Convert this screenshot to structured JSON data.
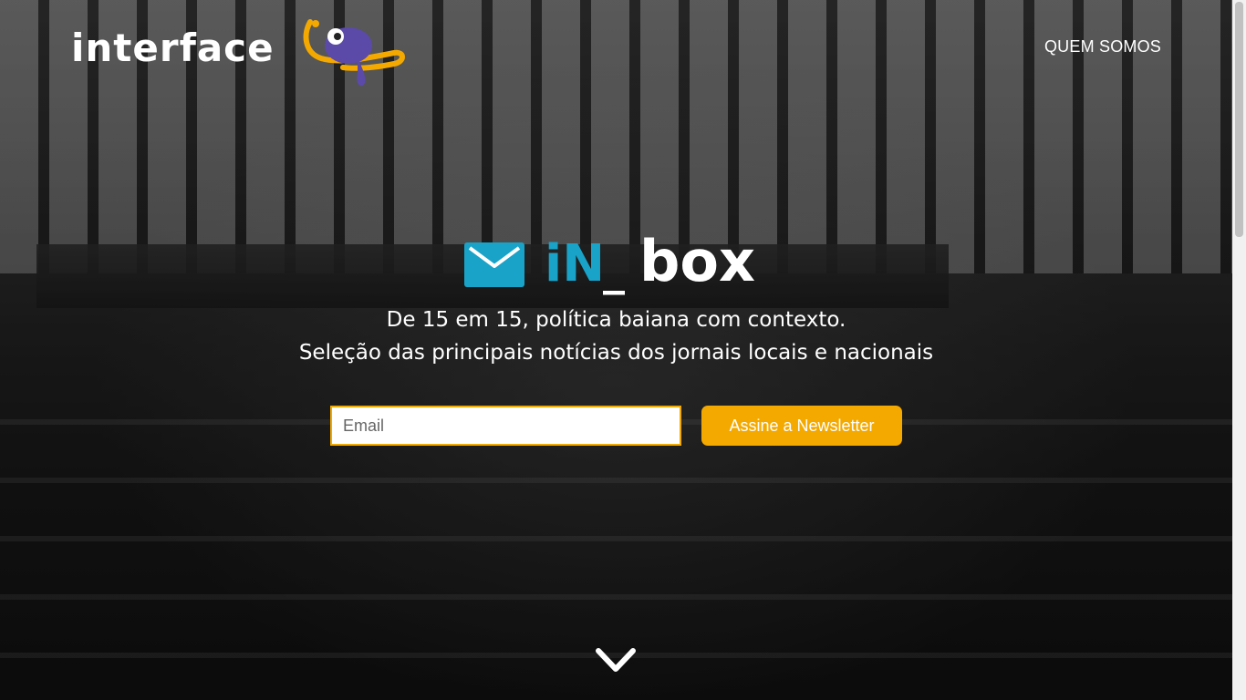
{
  "header": {
    "brand": "interface",
    "nav": {
      "about_label": "QUEM SOMOS"
    }
  },
  "hero": {
    "logo": {
      "in_text": "iN",
      "underscore": "_",
      "box_text": "box",
      "icon": "envelope-icon"
    },
    "tagline_line1": "De 15 em 15, política baiana com contexto.",
    "tagline_line2": "Seleção das principais notícias dos jornais locais e nacionais"
  },
  "newsletter": {
    "email_placeholder": "Email",
    "email_value": "",
    "subscribe_label": "Assine a Newsletter"
  },
  "icons": {
    "mascot": "chameleon-mascot-icon",
    "scroll_down": "chevron-down-icon"
  },
  "colors": {
    "accent": "#f4a900",
    "inbox_blue": "#19a3c8",
    "mascot_purple": "#5b4aa8",
    "text": "#ffffff"
  }
}
